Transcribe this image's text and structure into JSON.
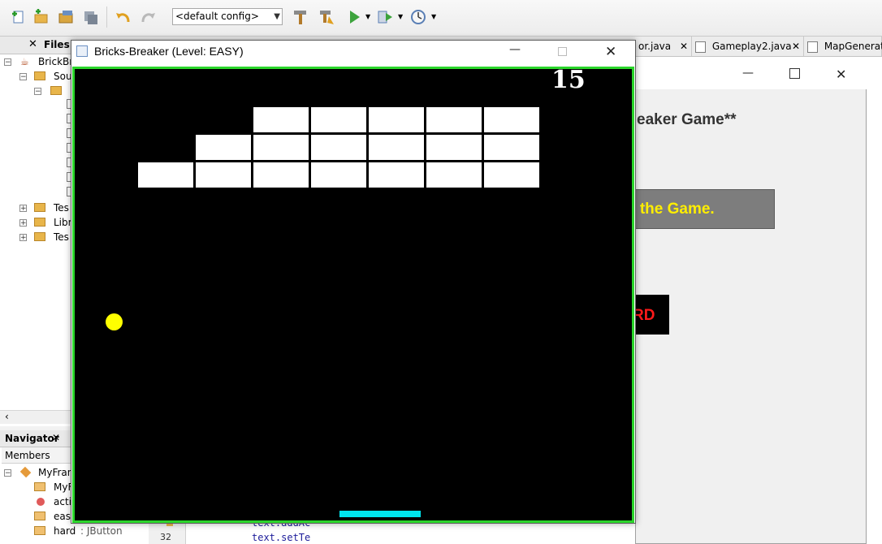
{
  "toolbar": {
    "config_value": "<default config>",
    "icons": [
      "new-file-icon",
      "new-project-icon",
      "open-project-icon",
      "save-all-icon",
      "undo-icon",
      "redo-icon",
      "build-icon",
      "clean-build-icon",
      "run-icon",
      "debug-icon",
      "profile-icon"
    ]
  },
  "projects": {
    "files_tab": "Files",
    "tree": [
      "BrickBr",
      "Sou",
      "Tes",
      "Libr",
      "Tes"
    ]
  },
  "editor": {
    "tabs": [
      "or.java",
      "Gameplay2.java",
      "MapGenerato"
    ],
    "line_number": "32",
    "code_lines": [
      "text.addAc",
      "text.setTe"
    ]
  },
  "navigator": {
    "tab": "Navigator",
    "members_label": "Members",
    "items": [
      {
        "label": "MyFran",
        "type": ""
      },
      {
        "label": "MyF",
        "type": ""
      },
      {
        "label": "actio",
        "type": ""
      },
      {
        "label": "easy",
        "type": ""
      },
      {
        "label": "hard",
        "type": ": JButton"
      }
    ]
  },
  "myframe": {
    "heading": "eaker Game**",
    "play_label": "y the Game.",
    "hard_label": "RD"
  },
  "game": {
    "title": "Bricks-Breaker (Level: EASY)",
    "score": "15",
    "colors": {
      "border": "#2bd62b",
      "ball": "#ffff00",
      "paddle": "#00e5ee",
      "brick": "#ffffff",
      "background": "#000000"
    },
    "brick_map": [
      [
        0,
        0,
        1,
        1,
        1,
        1,
        1
      ],
      [
        0,
        1,
        1,
        1,
        1,
        1,
        1
      ],
      [
        1,
        1,
        1,
        1,
        1,
        1,
        1
      ]
    ]
  }
}
